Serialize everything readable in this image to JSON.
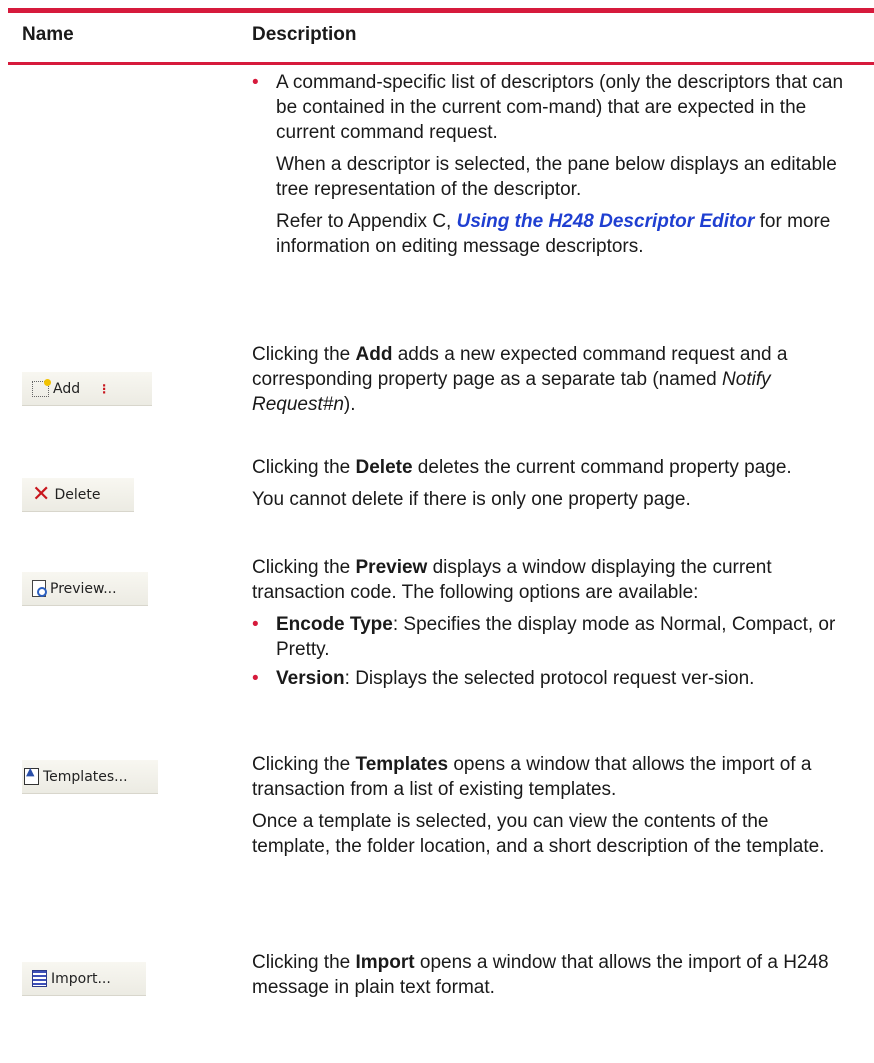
{
  "header": {
    "name": "Name",
    "description": "Description"
  },
  "descriptors_block": {
    "bullet": "A command-specific list of descriptors (only the descriptors that can be contained in the current com-mand) that are expected in the current command request.",
    "para1": "When a descriptor is selected, the pane below displays an editable tree representation of the descriptor.",
    "para2_pre": "Refer to Appendix C, ",
    "para2_link": "Using the H248 Descriptor Editor",
    "para2_post": " for more information on editing message descriptors."
  },
  "add": {
    "button_label": "Add",
    "pre": "Clicking the ",
    "bold": "Add",
    "post": "  adds a new expected command request and a corresponding property page as a separate tab (named ",
    "italic": "Notify Request#n",
    "end": ")."
  },
  "delete": {
    "button_label": "Delete",
    "pre": "Clicking the ",
    "bold": "Delete",
    "post": "  deletes the current command property page.",
    "note": "You cannot delete if there is only one property page."
  },
  "preview": {
    "button_label": "Preview...",
    "pre": "Clicking the ",
    "bold": "Preview",
    "post": "  displays a window displaying the current transaction code. The following options are available:",
    "opt1_bold": "Encode Type",
    "opt1_text": ": Specifies the display mode as Normal, Compact, or Pretty.",
    "opt2_bold": "Version",
    "opt2_text": ": Displays the selected protocol request ver-sion."
  },
  "templates": {
    "button_label": "Templates...",
    "pre": "Clicking the ",
    "bold": "Templates",
    "post": "  opens a window that allows the import of a transaction from a list of existing templates.",
    "para": "Once a template is selected, you can view the contents of the template, the folder location, and a short description of the template."
  },
  "import": {
    "button_label": "Import...",
    "pre": "Clicking the ",
    "bold": "Import",
    "post": "  opens a window that allows the import of a H248 message in plain text format."
  }
}
